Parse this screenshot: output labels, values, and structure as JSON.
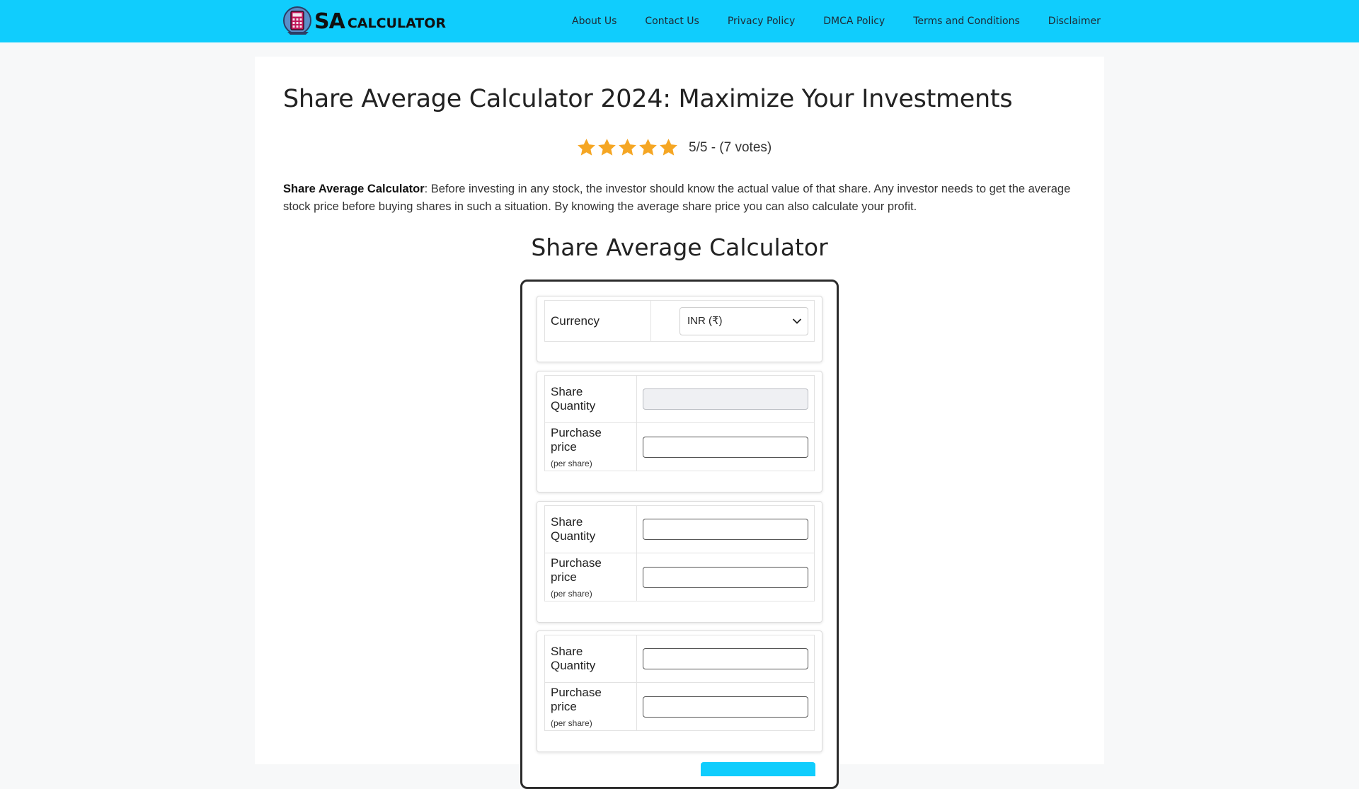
{
  "header": {
    "logo": {
      "sa": "SA",
      "calculator": "CALCULATOR"
    },
    "nav": [
      "About Us",
      "Contact Us",
      "Privacy Policy",
      "DMCA Policy",
      "Terms and Conditions",
      "Disclaimer"
    ]
  },
  "page": {
    "title": "Share Average Calculator 2024: Maximize Your Investments",
    "rating": {
      "stars": 5,
      "text": "5/5 - (7 votes)"
    },
    "intro_bold": "Share Average Calculator",
    "intro_text": ": Before investing in any stock, the investor should know the actual value of that share. Any investor needs to get the average stock price before buying shares in such a situation. By knowing the average share price you can also calculate your profit."
  },
  "calculator": {
    "title": "Share Average Calculator",
    "currency_label": "Currency",
    "currency_value": "INR (₹)",
    "groups": [
      {
        "quantity_label": "Share Quantity",
        "price_label": "Purchase price",
        "price_sub": "(per share)"
      },
      {
        "quantity_label": "Share Quantity",
        "price_label": "Purchase price",
        "price_sub": "(per share)"
      },
      {
        "quantity_label": "Share Quantity",
        "price_label": "Purchase price",
        "price_sub": "(per share)"
      }
    ]
  },
  "colors": {
    "header": "#10cdfd",
    "star": "#f5a623"
  }
}
